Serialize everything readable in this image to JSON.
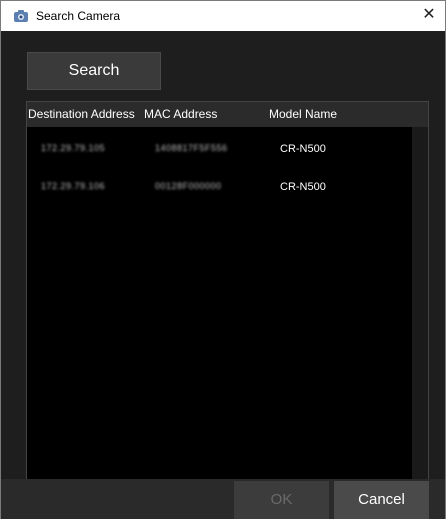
{
  "window": {
    "title": "Search Camera",
    "close_symbol": "✕",
    "icon": "camera-app-icon"
  },
  "toolbar": {
    "search_label": "Search"
  },
  "table": {
    "columns": [
      "Destination Address",
      "MAC Address",
      "Model Name"
    ],
    "rows": [
      {
        "destination": "172.29.79.105",
        "mac": "1408817F5F556",
        "model": "CR-N500"
      },
      {
        "destination": "172.29.79.106",
        "mac": "00128F000000",
        "model": "CR-N500"
      }
    ]
  },
  "footer": {
    "ok_label": "OK",
    "cancel_label": "Cancel"
  },
  "colors": {
    "background": "#1e1e1e",
    "table_background": "#000000",
    "header_background": "#2b2b2b",
    "button_background": "#3a3a3a",
    "disabled_text": "#6a6a6a"
  }
}
